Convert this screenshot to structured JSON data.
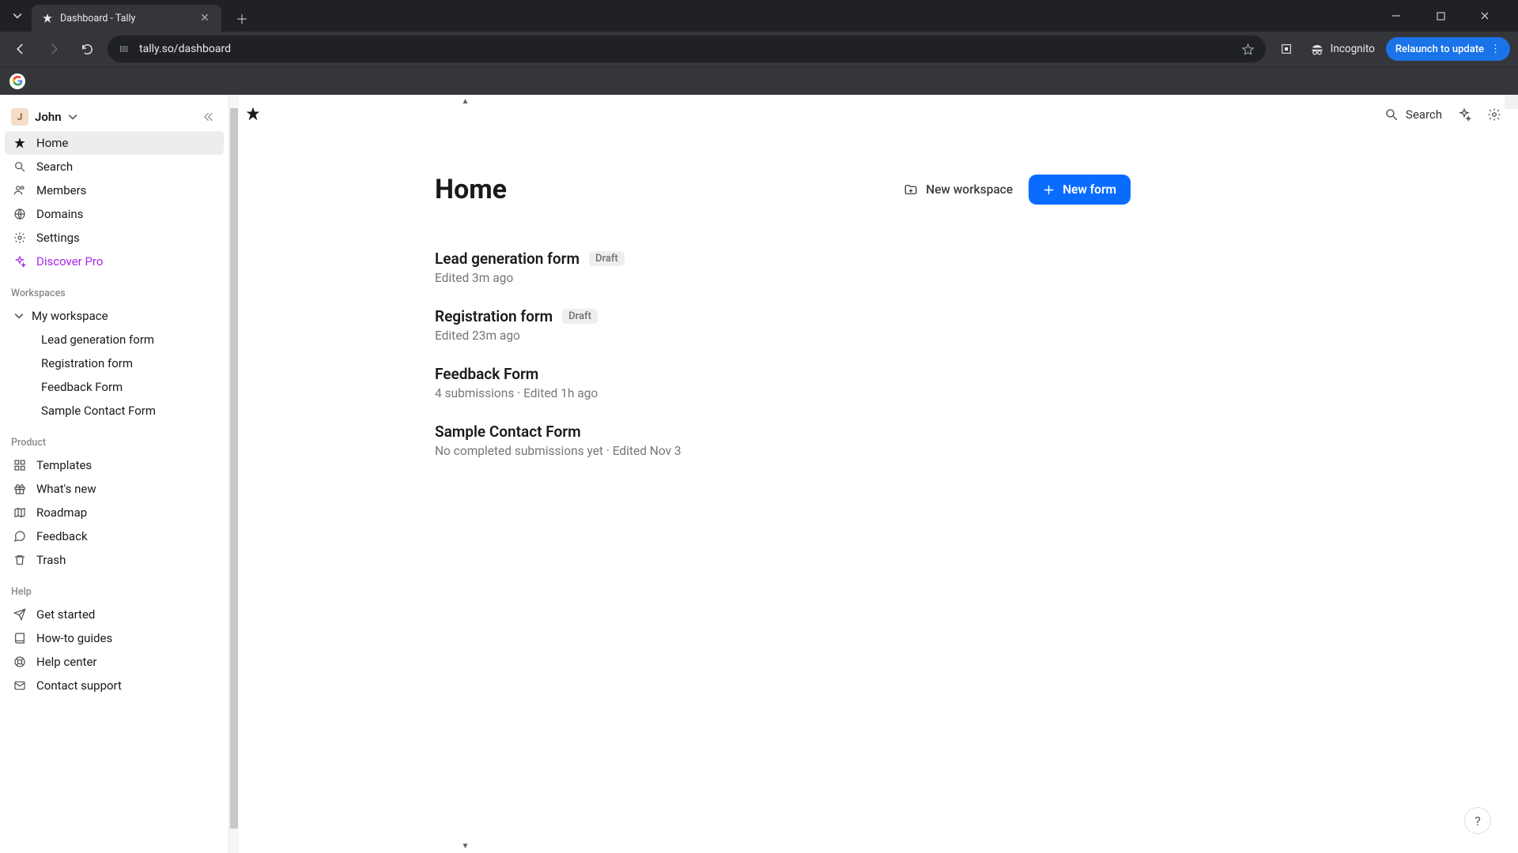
{
  "browser": {
    "tab_title": "Dashboard - Tally",
    "url": "tally.so/dashboard",
    "incognito_label": "Incognito",
    "relaunch_label": "Relaunch to update"
  },
  "sidebar": {
    "user_initial": "J",
    "user_name": "John",
    "nav": {
      "home": "Home",
      "search": "Search",
      "members": "Members",
      "domains": "Domains",
      "settings": "Settings",
      "discover_pro": "Discover Pro"
    },
    "workspaces_label": "Workspaces",
    "workspace_name": "My workspace",
    "workspace_forms": [
      "Lead generation form",
      "Registration form",
      "Feedback Form",
      "Sample Contact Form"
    ],
    "product_label": "Product",
    "product_items": {
      "templates": "Templates",
      "whats_new": "What's new",
      "roadmap": "Roadmap",
      "feedback": "Feedback",
      "trash": "Trash"
    },
    "help_label": "Help",
    "help_items": {
      "get_started": "Get started",
      "how_to_guides": "How-to guides",
      "help_center": "Help center",
      "contact_support": "Contact support"
    }
  },
  "main": {
    "page_title": "Home",
    "search_label": "Search",
    "new_workspace_label": "New workspace",
    "new_form_label": "New form",
    "forms": [
      {
        "title": "Lead generation form",
        "badge": "Draft",
        "meta": "Edited 3m ago"
      },
      {
        "title": "Registration form",
        "badge": "Draft",
        "meta": "Edited 23m ago"
      },
      {
        "title": "Feedback Form",
        "badge": "",
        "meta": "4 submissions · Edited 1h ago"
      },
      {
        "title": "Sample Contact Form",
        "badge": "",
        "meta": "No completed submissions yet · Edited Nov 3"
      }
    ]
  }
}
